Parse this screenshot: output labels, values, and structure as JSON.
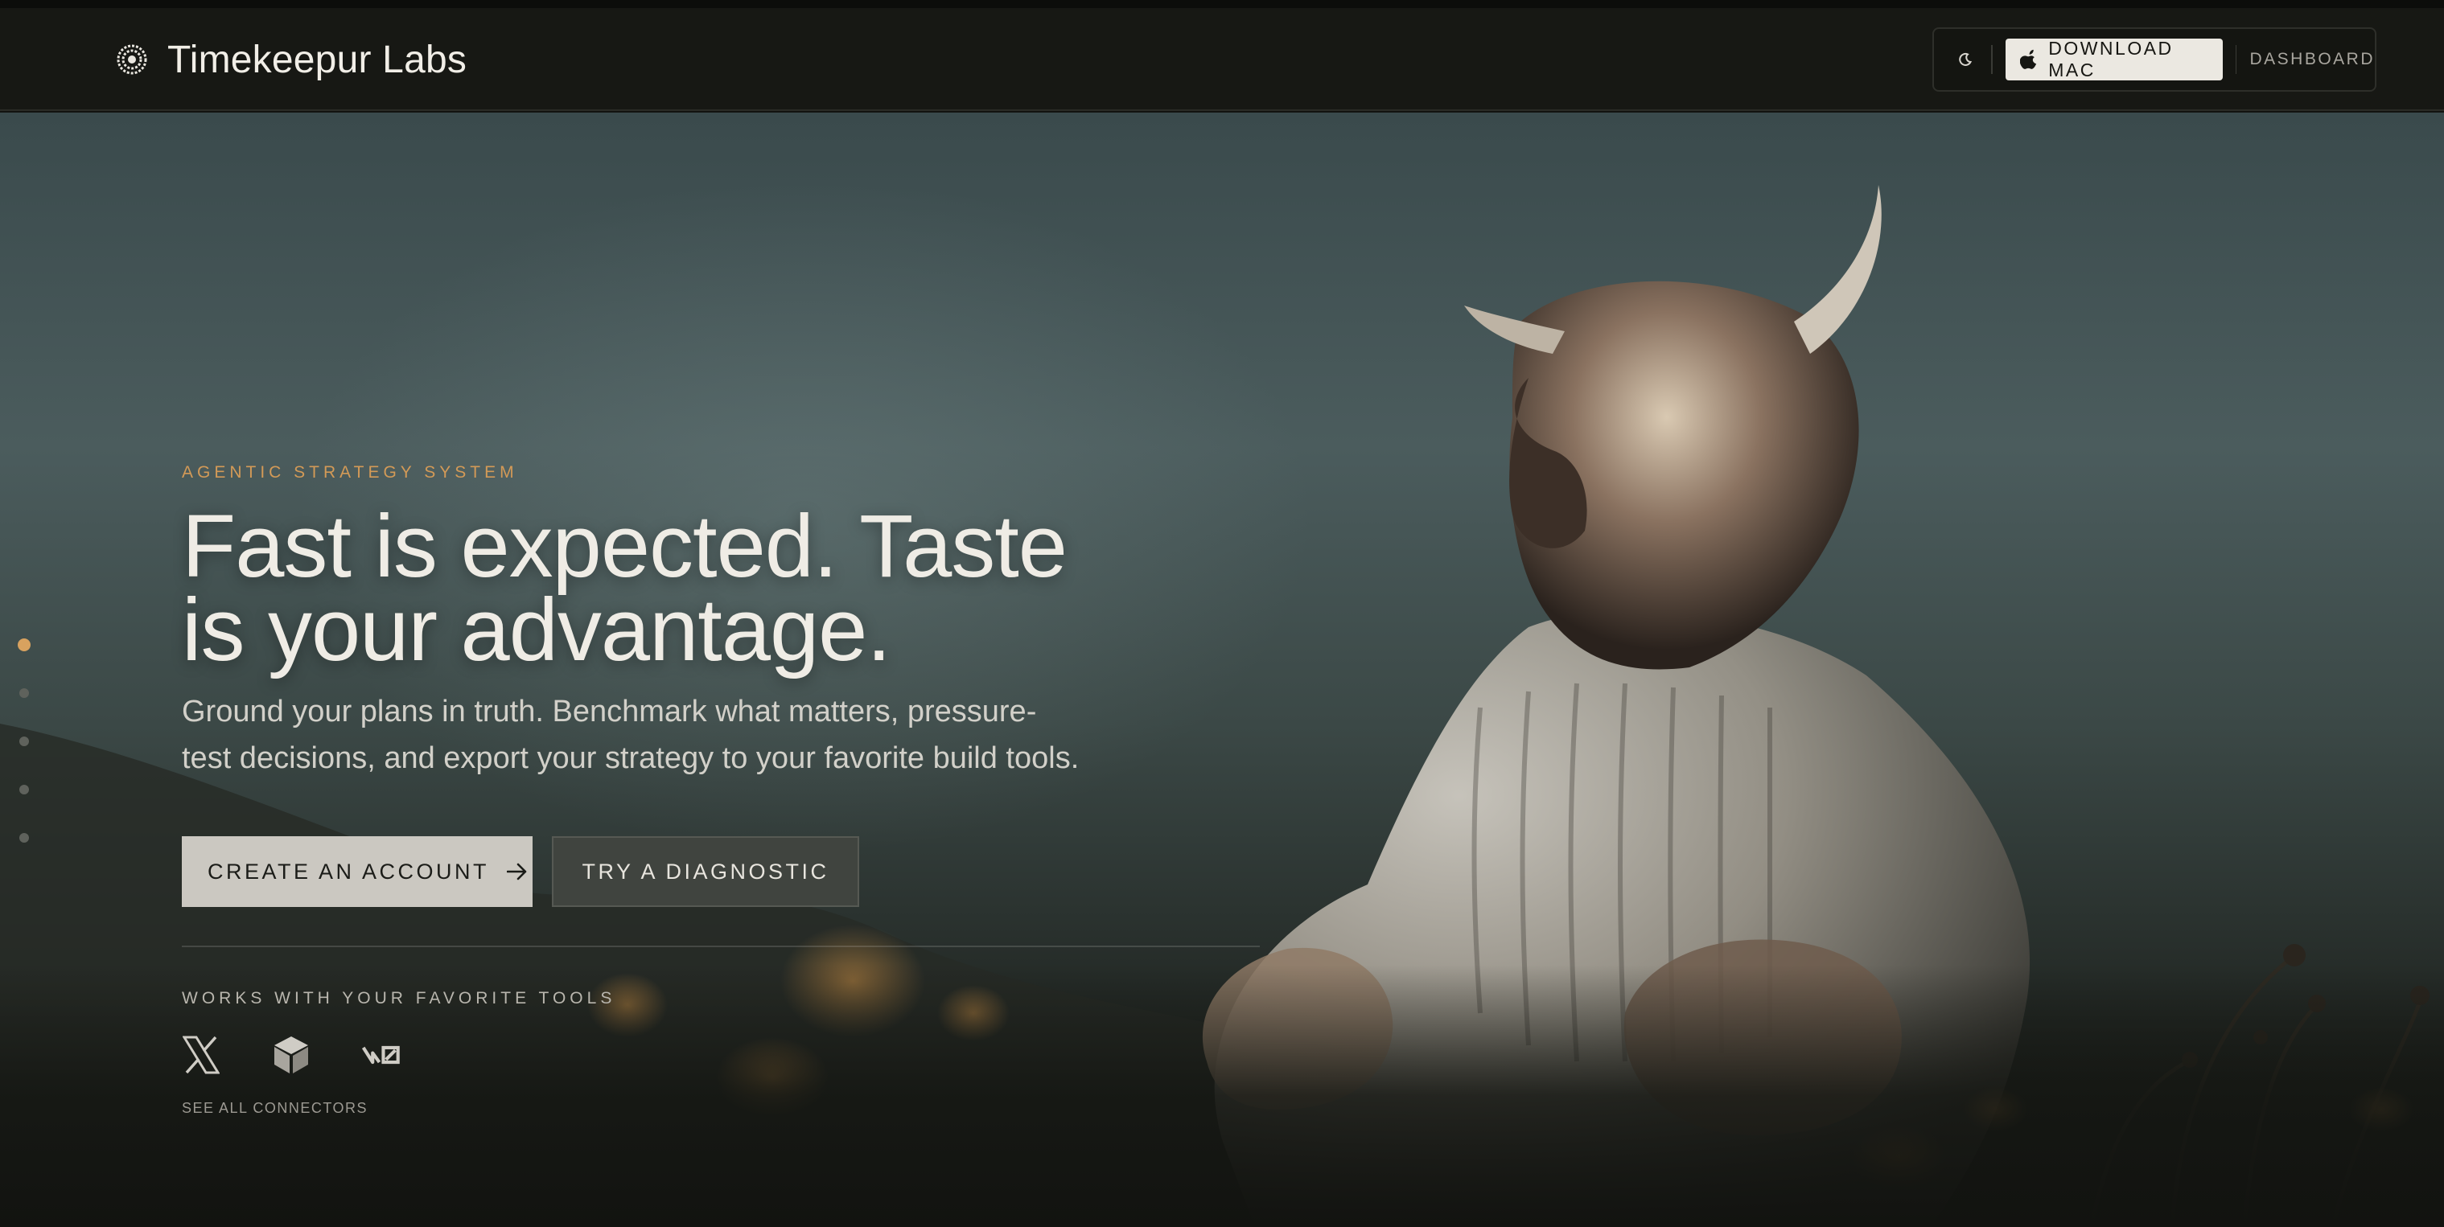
{
  "brand": {
    "name": "Timekeepur Labs",
    "logo_icon": "spiral-logo-icon"
  },
  "nav": {
    "theme_icon": "moon-icon",
    "download_label": "DOWNLOAD MAC",
    "download_icon": "apple-icon",
    "dashboard_label": "DASHBOARD"
  },
  "hero": {
    "eyebrow": "AGENTIC STRATEGY SYSTEM",
    "headline_line1": "Fast is expected. Taste",
    "headline_line2": "is your advantage.",
    "subtitle_line1": "Ground your plans in truth. Benchmark what matters, pressure-",
    "subtitle_line2": "test decisions, and export your strategy to your favorite build tools.",
    "primary_cta": "CREATE AN ACCOUNT",
    "primary_cta_icon": "arrow-right-icon",
    "secondary_cta": "TRY A DIAGNOSTIC"
  },
  "tools": {
    "heading": "WORKS WITH YOUR FAVORITE TOOLS",
    "items": [
      {
        "icon": "x-logo-icon"
      },
      {
        "icon": "cube-icon"
      },
      {
        "icon": "v0-logo-icon"
      }
    ],
    "see_all": "SEE ALL CONNECTORS"
  },
  "section_dots": {
    "count": 5,
    "active": 1
  },
  "colors": {
    "accent": "#d8a25f",
    "nav_bg": "#171814",
    "button_light": "#ebe8e1",
    "button_secondary": "#40443f"
  }
}
